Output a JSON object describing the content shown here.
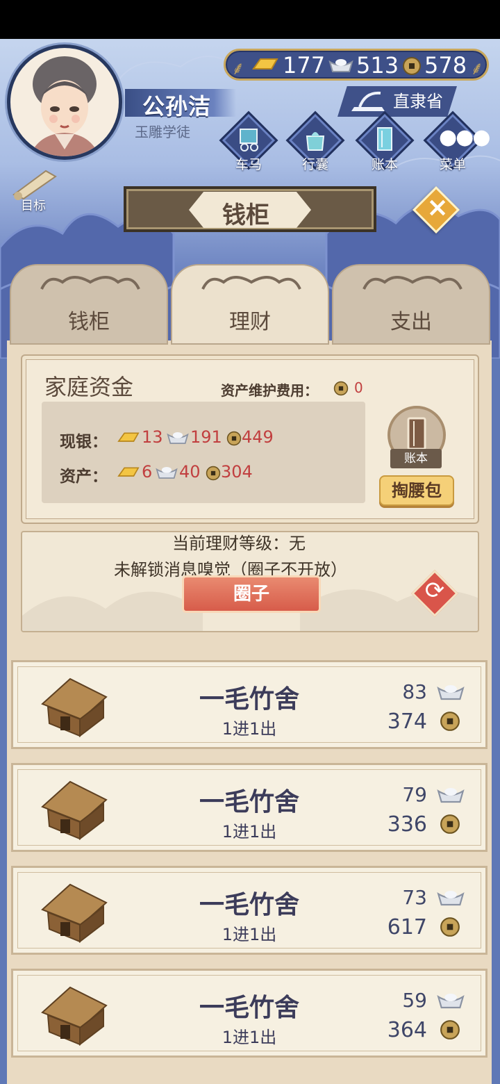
{
  "player": {
    "name": "公孙洁",
    "title": "玉雕学徒"
  },
  "currency": {
    "gold": "177",
    "silver": "513",
    "coin": "578"
  },
  "location": "直隶省",
  "nav": [
    {
      "label": "车马"
    },
    {
      "label": "行囊"
    },
    {
      "label": "账本"
    },
    {
      "label": "菜单"
    }
  ],
  "goal": "目标",
  "header": {
    "title": "钱柜"
  },
  "tabs": [
    {
      "label": "钱柜"
    },
    {
      "label": "理财"
    },
    {
      "label": "支出"
    }
  ],
  "family": {
    "title": "家庭资金",
    "maintenance_label": "资产维护费用：",
    "maintenance_value": "0",
    "cash_label": "现银：",
    "cash": {
      "gold": "13",
      "silver": "191",
      "coin": "449"
    },
    "assets_label": "资产：",
    "assets": {
      "gold": "6",
      "silver": "40",
      "coin": "304"
    },
    "ledger_label": "账本",
    "pocket_button": "掏腰包"
  },
  "finance": {
    "level": "当前理财等级：无",
    "note": "未解锁消息嗅觉（圈子不开放）",
    "circle_button": "圈子"
  },
  "properties": [
    {
      "name": "一毛竹舍",
      "sub": "1进1出",
      "silver": "83",
      "coin": "374"
    },
    {
      "name": "一毛竹舍",
      "sub": "1进1出",
      "silver": "79",
      "coin": "336"
    },
    {
      "name": "一毛竹舍",
      "sub": "1进1出",
      "silver": "73",
      "coin": "617"
    },
    {
      "name": "一毛竹舍",
      "sub": "1进1出",
      "silver": "59",
      "coin": "364"
    }
  ]
}
